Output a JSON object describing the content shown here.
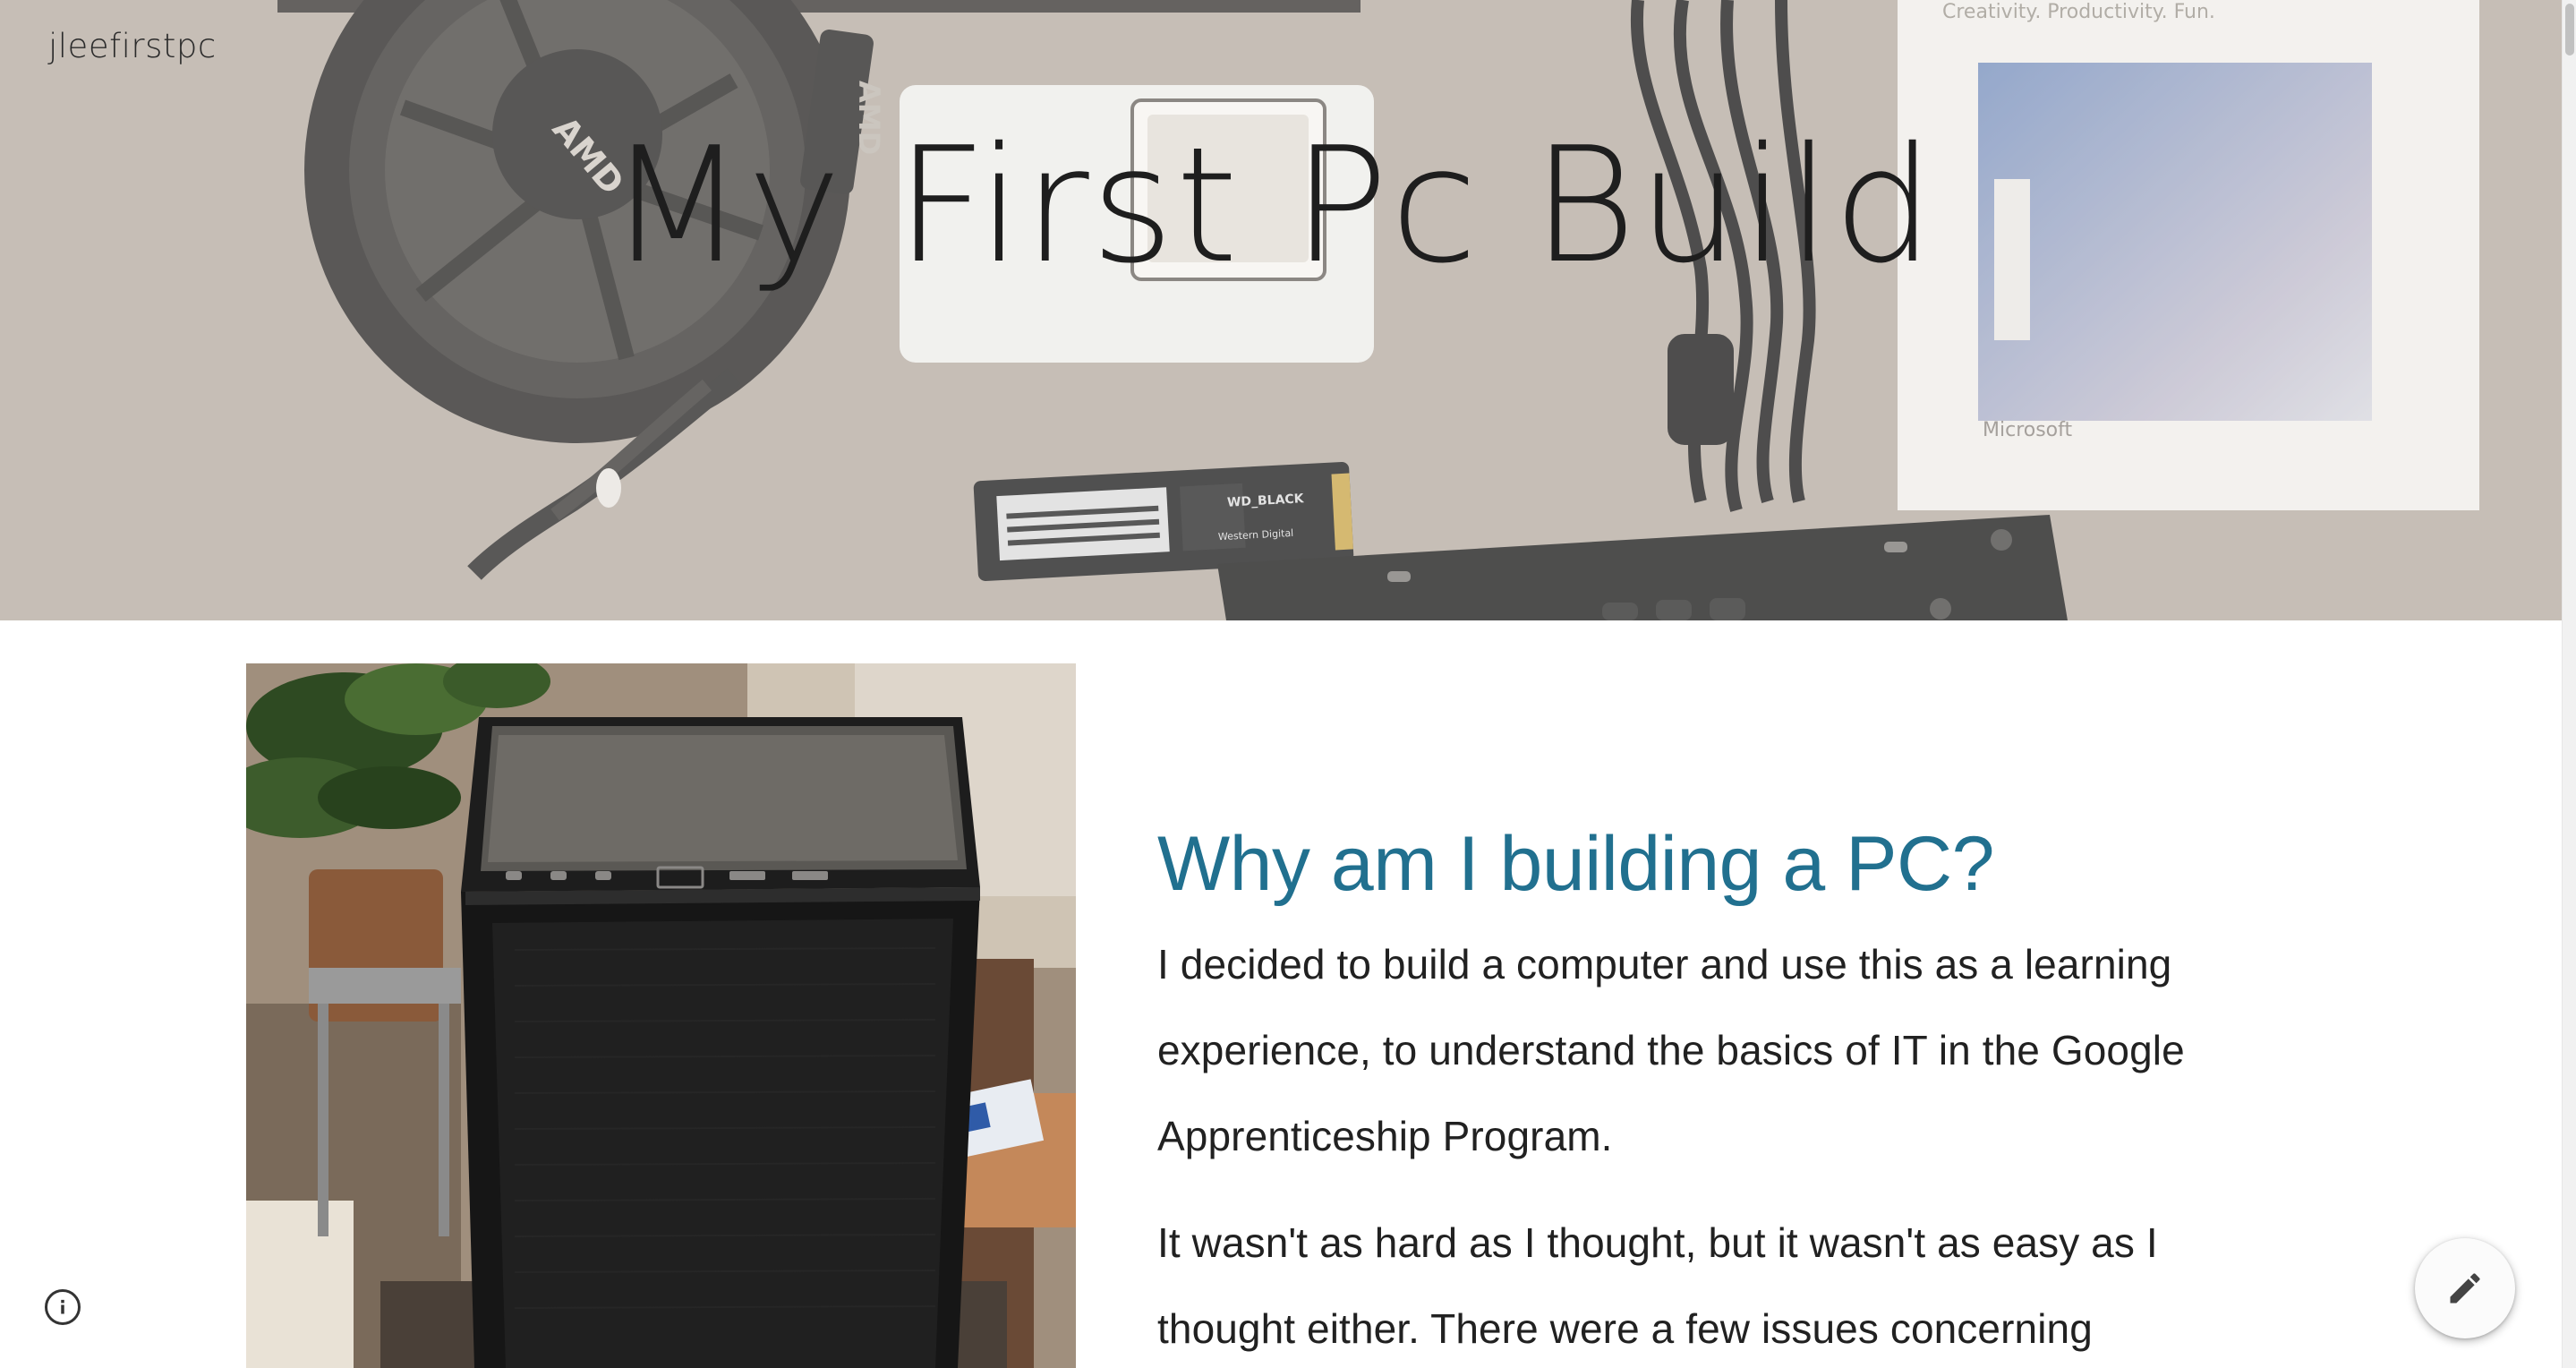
{
  "site": {
    "name": "jleefirstpc"
  },
  "hero": {
    "title": "My First Pc Build",
    "image_text": {
      "cooler_brand": "AMD",
      "cooler_cable_brand": "AMD",
      "box_tagline": "Creativity. Productivity. Fun.",
      "box_brand": "Microsoft",
      "ssd_brand": "WD_BLACK",
      "ssd_maker": "Western Digital"
    }
  },
  "section": {
    "heading": "Why am I building a PC?",
    "paragraphs": [
      "I decided to build a computer and use this as a learning experience, to understand the basics of IT in the Google Apprenticeship Program.",
      "It wasn't as hard as I thought, but it wasn't as easy as I thought either. There were a few issues concerning"
    ]
  },
  "controls": {
    "info_icon": "info-icon",
    "edit_icon": "pencil-icon"
  },
  "colors": {
    "heading": "#21708f",
    "body_text": "#212121",
    "site_name": "#2b2b2b"
  }
}
